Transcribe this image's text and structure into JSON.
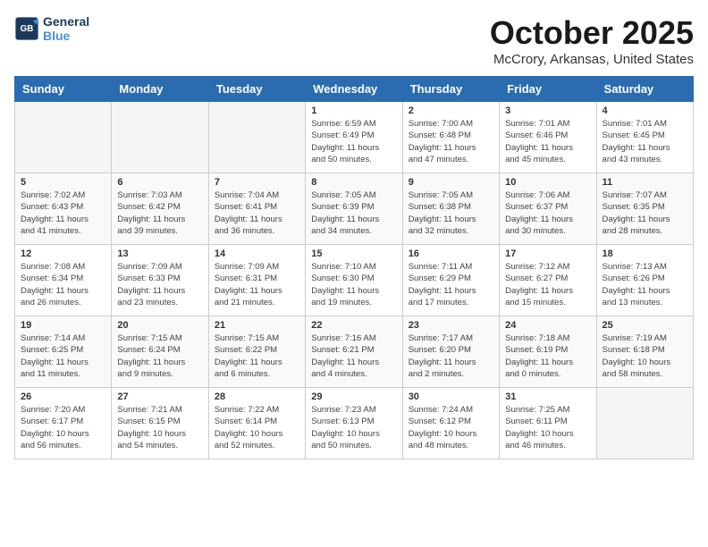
{
  "logo": {
    "line1": "General",
    "line2": "Blue"
  },
  "title": "October 2025",
  "location": "McCrory, Arkansas, United States",
  "headers": [
    "Sunday",
    "Monday",
    "Tuesday",
    "Wednesday",
    "Thursday",
    "Friday",
    "Saturday"
  ],
  "weeks": [
    [
      {
        "day": "",
        "detail": ""
      },
      {
        "day": "",
        "detail": ""
      },
      {
        "day": "",
        "detail": ""
      },
      {
        "day": "1",
        "detail": "Sunrise: 6:59 AM\nSunset: 6:49 PM\nDaylight: 11 hours\nand 50 minutes."
      },
      {
        "day": "2",
        "detail": "Sunrise: 7:00 AM\nSunset: 6:48 PM\nDaylight: 11 hours\nand 47 minutes."
      },
      {
        "day": "3",
        "detail": "Sunrise: 7:01 AM\nSunset: 6:46 PM\nDaylight: 11 hours\nand 45 minutes."
      },
      {
        "day": "4",
        "detail": "Sunrise: 7:01 AM\nSunset: 6:45 PM\nDaylight: 11 hours\nand 43 minutes."
      }
    ],
    [
      {
        "day": "5",
        "detail": "Sunrise: 7:02 AM\nSunset: 6:43 PM\nDaylight: 11 hours\nand 41 minutes."
      },
      {
        "day": "6",
        "detail": "Sunrise: 7:03 AM\nSunset: 6:42 PM\nDaylight: 11 hours\nand 39 minutes."
      },
      {
        "day": "7",
        "detail": "Sunrise: 7:04 AM\nSunset: 6:41 PM\nDaylight: 11 hours\nand 36 minutes."
      },
      {
        "day": "8",
        "detail": "Sunrise: 7:05 AM\nSunset: 6:39 PM\nDaylight: 11 hours\nand 34 minutes."
      },
      {
        "day": "9",
        "detail": "Sunrise: 7:05 AM\nSunset: 6:38 PM\nDaylight: 11 hours\nand 32 minutes."
      },
      {
        "day": "10",
        "detail": "Sunrise: 7:06 AM\nSunset: 6:37 PM\nDaylight: 11 hours\nand 30 minutes."
      },
      {
        "day": "11",
        "detail": "Sunrise: 7:07 AM\nSunset: 6:35 PM\nDaylight: 11 hours\nand 28 minutes."
      }
    ],
    [
      {
        "day": "12",
        "detail": "Sunrise: 7:08 AM\nSunset: 6:34 PM\nDaylight: 11 hours\nand 26 minutes."
      },
      {
        "day": "13",
        "detail": "Sunrise: 7:09 AM\nSunset: 6:33 PM\nDaylight: 11 hours\nand 23 minutes."
      },
      {
        "day": "14",
        "detail": "Sunrise: 7:09 AM\nSunset: 6:31 PM\nDaylight: 11 hours\nand 21 minutes."
      },
      {
        "day": "15",
        "detail": "Sunrise: 7:10 AM\nSunset: 6:30 PM\nDaylight: 11 hours\nand 19 minutes."
      },
      {
        "day": "16",
        "detail": "Sunrise: 7:11 AM\nSunset: 6:29 PM\nDaylight: 11 hours\nand 17 minutes."
      },
      {
        "day": "17",
        "detail": "Sunrise: 7:12 AM\nSunset: 6:27 PM\nDaylight: 11 hours\nand 15 minutes."
      },
      {
        "day": "18",
        "detail": "Sunrise: 7:13 AM\nSunset: 6:26 PM\nDaylight: 11 hours\nand 13 minutes."
      }
    ],
    [
      {
        "day": "19",
        "detail": "Sunrise: 7:14 AM\nSunset: 6:25 PM\nDaylight: 11 hours\nand 11 minutes."
      },
      {
        "day": "20",
        "detail": "Sunrise: 7:15 AM\nSunset: 6:24 PM\nDaylight: 11 hours\nand 9 minutes."
      },
      {
        "day": "21",
        "detail": "Sunrise: 7:15 AM\nSunset: 6:22 PM\nDaylight: 11 hours\nand 6 minutes."
      },
      {
        "day": "22",
        "detail": "Sunrise: 7:16 AM\nSunset: 6:21 PM\nDaylight: 11 hours\nand 4 minutes."
      },
      {
        "day": "23",
        "detail": "Sunrise: 7:17 AM\nSunset: 6:20 PM\nDaylight: 11 hours\nand 2 minutes."
      },
      {
        "day": "24",
        "detail": "Sunrise: 7:18 AM\nSunset: 6:19 PM\nDaylight: 11 hours\nand 0 minutes."
      },
      {
        "day": "25",
        "detail": "Sunrise: 7:19 AM\nSunset: 6:18 PM\nDaylight: 10 hours\nand 58 minutes."
      }
    ],
    [
      {
        "day": "26",
        "detail": "Sunrise: 7:20 AM\nSunset: 6:17 PM\nDaylight: 10 hours\nand 56 minutes."
      },
      {
        "day": "27",
        "detail": "Sunrise: 7:21 AM\nSunset: 6:15 PM\nDaylight: 10 hours\nand 54 minutes."
      },
      {
        "day": "28",
        "detail": "Sunrise: 7:22 AM\nSunset: 6:14 PM\nDaylight: 10 hours\nand 52 minutes."
      },
      {
        "day": "29",
        "detail": "Sunrise: 7:23 AM\nSunset: 6:13 PM\nDaylight: 10 hours\nand 50 minutes."
      },
      {
        "day": "30",
        "detail": "Sunrise: 7:24 AM\nSunset: 6:12 PM\nDaylight: 10 hours\nand 48 minutes."
      },
      {
        "day": "31",
        "detail": "Sunrise: 7:25 AM\nSunset: 6:11 PM\nDaylight: 10 hours\nand 46 minutes."
      },
      {
        "day": "",
        "detail": ""
      }
    ]
  ]
}
